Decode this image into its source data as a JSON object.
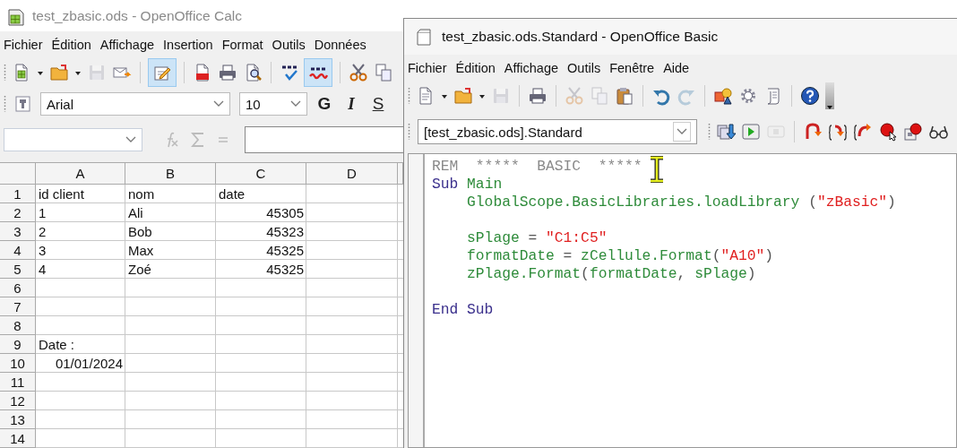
{
  "calc": {
    "title": "test_zbasic.ods - OpenOffice Calc",
    "menu": [
      "Fichier",
      "Édition",
      "Affichage",
      "Insertion",
      "Format",
      "Outils",
      "Données"
    ],
    "toolbar": [
      {
        "pressed": false,
        "disabled": false
      },
      {
        "pressed": false,
        "disabled": false
      },
      {
        "pressed": false,
        "disabled": true
      },
      {
        "pressed": false,
        "disabled": false
      },
      {
        "pressed": true,
        "disabled": false
      },
      {
        "pressed": false,
        "disabled": false
      },
      {
        "pressed": false,
        "disabled": false
      },
      {
        "pressed": false,
        "disabled": false
      },
      {
        "pressed": false,
        "disabled": false
      },
      {
        "pressed": true,
        "disabled": false
      },
      {
        "pressed": false,
        "disabled": false
      },
      {
        "pressed": false,
        "disabled": false
      }
    ],
    "font_name": "Arial",
    "font_size": "10",
    "format_buttons": [
      "G",
      "I",
      "S"
    ],
    "columns": [
      "A",
      "B",
      "C",
      "D"
    ],
    "rows": [
      {
        "header": "1",
        "cells": [
          {
            "text": "id client",
            "kind": "text"
          },
          {
            "text": "nom",
            "kind": "text"
          },
          {
            "text": "date",
            "kind": "text"
          }
        ]
      },
      {
        "header": "2",
        "cells": [
          {
            "text": "1",
            "kind": "text"
          },
          {
            "text": "Ali",
            "kind": "text"
          },
          {
            "text": "45305",
            "kind": "number"
          }
        ]
      },
      {
        "header": "3",
        "cells": [
          {
            "text": "2",
            "kind": "text"
          },
          {
            "text": "Bob",
            "kind": "text"
          },
          {
            "text": "45323",
            "kind": "number"
          }
        ]
      },
      {
        "header": "4",
        "cells": [
          {
            "text": "3",
            "kind": "text"
          },
          {
            "text": "Max",
            "kind": "text"
          },
          {
            "text": "45325",
            "kind": "number"
          }
        ]
      },
      {
        "header": "5",
        "cells": [
          {
            "text": "4",
            "kind": "text"
          },
          {
            "text": "Zoé",
            "kind": "text"
          },
          {
            "text": "45325",
            "kind": "number"
          }
        ]
      },
      {
        "header": "6"
      },
      {
        "header": "7"
      },
      {
        "header": "8"
      },
      {
        "header": "9",
        "cells": [
          {
            "text": "Date :",
            "kind": "text"
          }
        ]
      },
      {
        "header": "10",
        "cells": [
          {
            "text": "01/01/2024",
            "kind": "number"
          }
        ]
      },
      {
        "header": "11"
      },
      {
        "header": "12"
      },
      {
        "header": "13"
      },
      {
        "header": "14"
      }
    ]
  },
  "basic": {
    "title": "test_zbasic.ods.Standard - OpenOffice Basic",
    "menu": [
      "Fichier",
      "Édition",
      "Affichage",
      "Outils",
      "Fenêtre",
      "Aide"
    ],
    "toolbar": [
      {
        "disabled": false
      },
      {
        "disabled": false
      },
      {
        "disabled": true
      },
      {
        "disabled": false
      },
      {
        "disabled": true
      },
      {
        "disabled": true
      },
      {
        "disabled": false
      },
      {
        "disabled": false
      },
      {
        "disabled": true
      },
      {
        "disabled": false
      },
      {
        "disabled": false
      },
      {
        "disabled": false
      },
      {
        "disabled": false
      }
    ],
    "library": "[test_zbasic.ods].Standard",
    "macro_toolbar": [
      {
        "disabled": false
      },
      {
        "disabled": false
      },
      {
        "disabled": true
      },
      {
        "disabled": false
      },
      {
        "disabled": false
      },
      {
        "disabled": false
      },
      {
        "disabled": false
      },
      {
        "disabled": false
      },
      {
        "disabled": false
      }
    ],
    "code": [
      {
        "kind": "code",
        "tokens": [
          {
            "text": "REM  *****  BASIC  *****",
            "kind": "comment"
          }
        ]
      },
      {
        "kind": "code",
        "tokens": [
          {
            "text": "Sub ",
            "kind": "keyword"
          },
          {
            "text": "Main",
            "kind": "ident"
          }
        ]
      },
      {
        "kind": "code",
        "tokens": [
          {
            "text": "    GlobalScope.BasicLibraries.loadLibrary",
            "kind": "ident"
          },
          {
            "text": " (",
            "kind": "op"
          },
          {
            "text": "\"zBasic\"",
            "kind": "string"
          },
          {
            "text": ")",
            "kind": "op"
          }
        ]
      },
      {
        "kind": "blank"
      },
      {
        "kind": "code",
        "tokens": [
          {
            "text": "    sPlage",
            "kind": "ident"
          },
          {
            "text": " = ",
            "kind": "op"
          },
          {
            "text": "\"C1:C5\"",
            "kind": "string"
          }
        ]
      },
      {
        "kind": "code",
        "tokens": [
          {
            "text": "    formatDate",
            "kind": "ident"
          },
          {
            "text": " = ",
            "kind": "op"
          },
          {
            "text": "zCellule.Format",
            "kind": "ident"
          },
          {
            "text": "(",
            "kind": "op"
          },
          {
            "text": "\"A10\"",
            "kind": "string"
          },
          {
            "text": ")",
            "kind": "op"
          }
        ]
      },
      {
        "kind": "code",
        "tokens": [
          {
            "text": "    zPlage.Format",
            "kind": "ident"
          },
          {
            "text": "(",
            "kind": "op"
          },
          {
            "text": "formatDate",
            "kind": "ident"
          },
          {
            "text": ", ",
            "kind": "op"
          },
          {
            "text": "sPlage",
            "kind": "ident"
          },
          {
            "text": ")",
            "kind": "op"
          }
        ]
      },
      {
        "kind": "blank"
      },
      {
        "kind": "code",
        "tokens": [
          {
            "text": "End Sub",
            "kind": "keyword"
          }
        ]
      }
    ]
  }
}
